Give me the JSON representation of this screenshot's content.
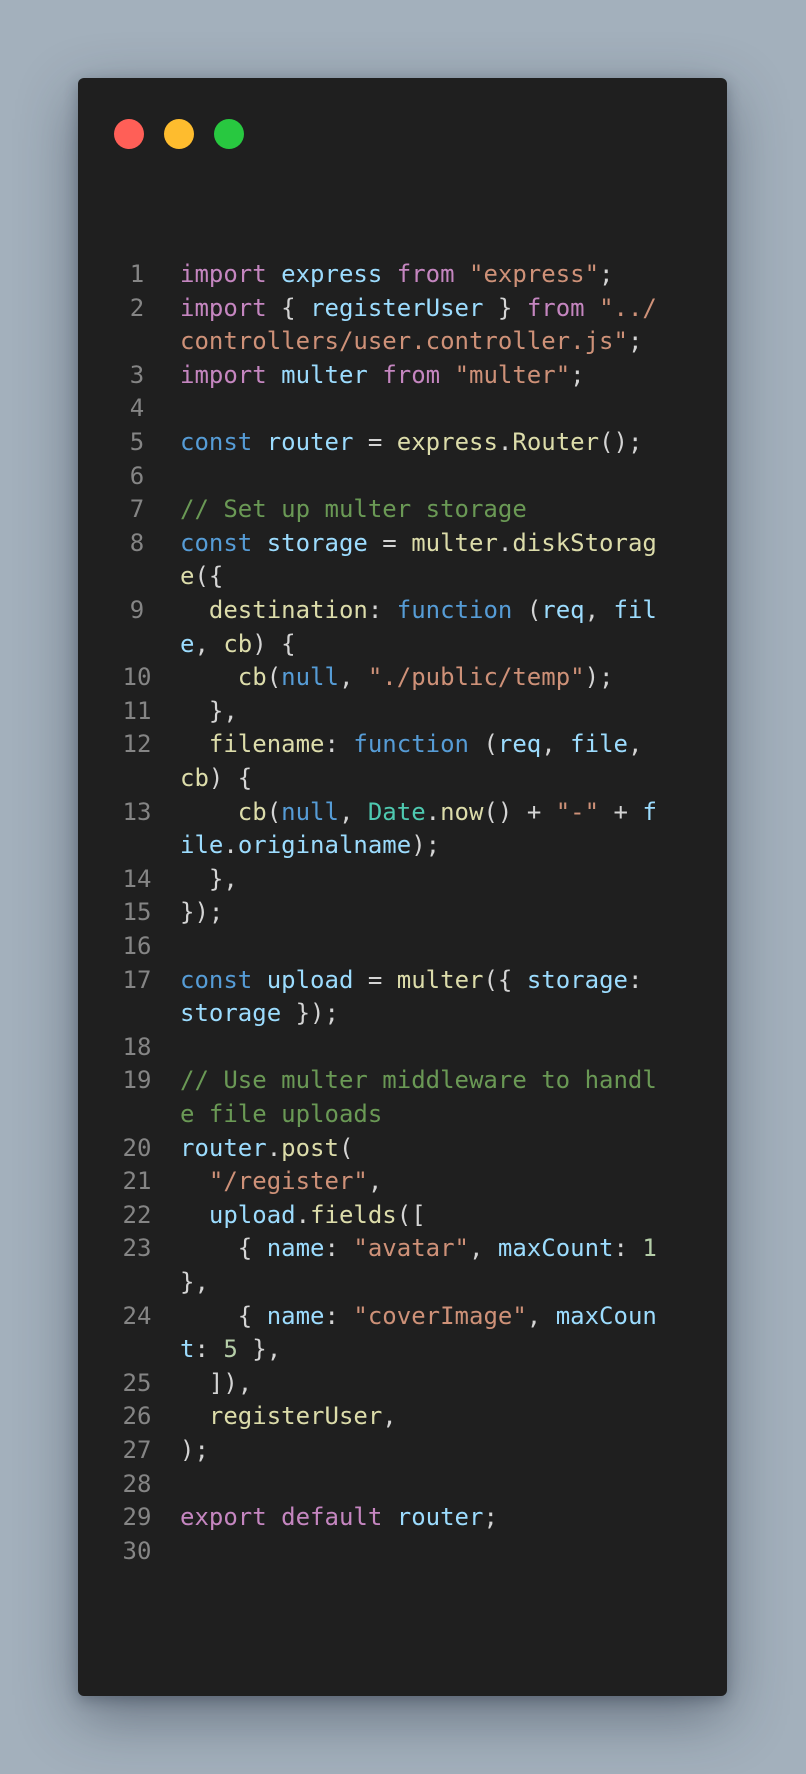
{
  "window": {
    "colors": {
      "background": "#1f1f1f",
      "red": "#ff5f57",
      "yellow": "#febc2e",
      "green": "#28c840"
    }
  },
  "syntax_colors": {
    "kw": "#c586c0",
    "var": "#9cdcfe",
    "str": "#ce9178",
    "plain": "#d4d4d4",
    "decl": "#569cd6",
    "fn": "#dcdcaa",
    "type": "#4ec9b0",
    "num": "#b5cea8",
    "cm": "#6a9955"
  },
  "code": {
    "lines": [
      {
        "n": "1",
        "rows": [
          [
            [
              "kw",
              "import "
            ],
            [
              "var",
              "express "
            ],
            [
              "kw",
              "from "
            ],
            [
              "str",
              "\"express\""
            ],
            [
              "plain",
              ";"
            ]
          ]
        ]
      },
      {
        "n": "2",
        "rows": [
          [
            [
              "kw",
              "import "
            ],
            [
              "plain",
              "{ "
            ],
            [
              "var",
              "registerUser "
            ],
            [
              "plain",
              "} "
            ],
            [
              "kw",
              "from "
            ],
            [
              "str",
              "\"../"
            ]
          ],
          [
            [
              "str",
              "controllers/user.controller.js\""
            ],
            [
              "plain",
              ";"
            ]
          ]
        ]
      },
      {
        "n": "3",
        "rows": [
          [
            [
              "kw",
              "import "
            ],
            [
              "var",
              "multer "
            ],
            [
              "kw",
              "from "
            ],
            [
              "str",
              "\"multer\""
            ],
            [
              "plain",
              ";"
            ]
          ]
        ]
      },
      {
        "n": "4",
        "rows": [
          []
        ]
      },
      {
        "n": "5",
        "rows": [
          [
            [
              "decl",
              "const "
            ],
            [
              "var",
              "router "
            ],
            [
              "plain",
              "= "
            ],
            [
              "fn",
              "express"
            ],
            [
              "plain",
              "."
            ],
            [
              "fn",
              "Router"
            ],
            [
              "plain",
              "();"
            ]
          ]
        ]
      },
      {
        "n": "6",
        "rows": [
          []
        ]
      },
      {
        "n": "7",
        "rows": [
          [
            [
              "cm",
              "// Set up multer storage"
            ]
          ]
        ]
      },
      {
        "n": "8",
        "rows": [
          [
            [
              "decl",
              "const "
            ],
            [
              "var",
              "storage "
            ],
            [
              "plain",
              "= "
            ],
            [
              "fn",
              "multer"
            ],
            [
              "plain",
              "."
            ],
            [
              "fn",
              "diskStorag"
            ]
          ],
          [
            [
              "fn",
              "e"
            ],
            [
              "plain",
              "({"
            ]
          ]
        ]
      },
      {
        "n": "9",
        "rows": [
          [
            [
              "plain",
              "  "
            ],
            [
              "fn",
              "destination"
            ],
            [
              "plain",
              ": "
            ],
            [
              "decl",
              "function "
            ],
            [
              "plain",
              "("
            ],
            [
              "var",
              "req"
            ],
            [
              "plain",
              ", "
            ],
            [
              "var",
              "fil"
            ]
          ],
          [
            [
              "var",
              "e"
            ],
            [
              "plain",
              ", "
            ],
            [
              "fn",
              "cb"
            ],
            [
              "plain",
              ") {"
            ]
          ]
        ]
      },
      {
        "n": "10",
        "rows": [
          [
            [
              "plain",
              "    "
            ],
            [
              "fn",
              "cb"
            ],
            [
              "plain",
              "("
            ],
            [
              "decl",
              "null"
            ],
            [
              "plain",
              ", "
            ],
            [
              "str",
              "\"./public/temp\""
            ],
            [
              "plain",
              ");"
            ]
          ]
        ]
      },
      {
        "n": "11",
        "rows": [
          [
            [
              "plain",
              "  },"
            ]
          ]
        ]
      },
      {
        "n": "12",
        "rows": [
          [
            [
              "plain",
              "  "
            ],
            [
              "fn",
              "filename"
            ],
            [
              "plain",
              ": "
            ],
            [
              "decl",
              "function "
            ],
            [
              "plain",
              "("
            ],
            [
              "var",
              "req"
            ],
            [
              "plain",
              ", "
            ],
            [
              "var",
              "file"
            ],
            [
              "plain",
              ","
            ]
          ],
          [
            [
              "fn",
              "cb"
            ],
            [
              "plain",
              ") {"
            ]
          ]
        ]
      },
      {
        "n": "13",
        "rows": [
          [
            [
              "plain",
              "    "
            ],
            [
              "fn",
              "cb"
            ],
            [
              "plain",
              "("
            ],
            [
              "decl",
              "null"
            ],
            [
              "plain",
              ", "
            ],
            [
              "type",
              "Date"
            ],
            [
              "plain",
              "."
            ],
            [
              "fn",
              "now"
            ],
            [
              "plain",
              "() + "
            ],
            [
              "str",
              "\"-\""
            ],
            [
              "plain",
              " + "
            ],
            [
              "var",
              "f"
            ]
          ],
          [
            [
              "var",
              "ile"
            ],
            [
              "plain",
              "."
            ],
            [
              "var",
              "originalname"
            ],
            [
              "plain",
              ");"
            ]
          ]
        ]
      },
      {
        "n": "14",
        "rows": [
          [
            [
              "plain",
              "  },"
            ]
          ]
        ]
      },
      {
        "n": "15",
        "rows": [
          [
            [
              "plain",
              "});"
            ]
          ]
        ]
      },
      {
        "n": "16",
        "rows": [
          []
        ]
      },
      {
        "n": "17",
        "rows": [
          [
            [
              "decl",
              "const "
            ],
            [
              "var",
              "upload "
            ],
            [
              "plain",
              "= "
            ],
            [
              "fn",
              "multer"
            ],
            [
              "plain",
              "({ "
            ],
            [
              "var",
              "storage"
            ],
            [
              "plain",
              ":"
            ]
          ],
          [
            [
              "var",
              "storage "
            ],
            [
              "plain",
              "});"
            ]
          ]
        ]
      },
      {
        "n": "18",
        "rows": [
          []
        ]
      },
      {
        "n": "19",
        "rows": [
          [
            [
              "cm",
              "// Use multer middleware to handl"
            ]
          ],
          [
            [
              "cm",
              "e file uploads"
            ]
          ]
        ]
      },
      {
        "n": "20",
        "rows": [
          [
            [
              "var",
              "router"
            ],
            [
              "plain",
              "."
            ],
            [
              "fn",
              "post"
            ],
            [
              "plain",
              "("
            ]
          ]
        ]
      },
      {
        "n": "21",
        "rows": [
          [
            [
              "plain",
              "  "
            ],
            [
              "str",
              "\"/register\""
            ],
            [
              "plain",
              ","
            ]
          ]
        ]
      },
      {
        "n": "22",
        "rows": [
          [
            [
              "plain",
              "  "
            ],
            [
              "var",
              "upload"
            ],
            [
              "plain",
              "."
            ],
            [
              "fn",
              "fields"
            ],
            [
              "plain",
              "(["
            ]
          ]
        ]
      },
      {
        "n": "23",
        "rows": [
          [
            [
              "plain",
              "    { "
            ],
            [
              "var",
              "name"
            ],
            [
              "plain",
              ": "
            ],
            [
              "str",
              "\"avatar\""
            ],
            [
              "plain",
              ", "
            ],
            [
              "var",
              "maxCount"
            ],
            [
              "plain",
              ": "
            ],
            [
              "num",
              "1"
            ]
          ],
          [
            [
              "plain",
              "},"
            ]
          ]
        ]
      },
      {
        "n": "24",
        "rows": [
          [
            [
              "plain",
              "    { "
            ],
            [
              "var",
              "name"
            ],
            [
              "plain",
              ": "
            ],
            [
              "str",
              "\"coverImage\""
            ],
            [
              "plain",
              ", "
            ],
            [
              "var",
              "maxCoun"
            ]
          ],
          [
            [
              "var",
              "t"
            ],
            [
              "plain",
              ": "
            ],
            [
              "num",
              "5"
            ],
            [
              "plain",
              " },"
            ]
          ]
        ]
      },
      {
        "n": "25",
        "rows": [
          [
            [
              "plain",
              "  ]),"
            ]
          ]
        ]
      },
      {
        "n": "26",
        "rows": [
          [
            [
              "plain",
              "  "
            ],
            [
              "fn",
              "registerUser"
            ],
            [
              "plain",
              ","
            ]
          ]
        ]
      },
      {
        "n": "27",
        "rows": [
          [
            [
              "plain",
              ");"
            ]
          ]
        ]
      },
      {
        "n": "28",
        "rows": [
          []
        ]
      },
      {
        "n": "29",
        "rows": [
          [
            [
              "kw",
              "export "
            ],
            [
              "kw",
              "default "
            ],
            [
              "var",
              "router"
            ],
            [
              "plain",
              ";"
            ]
          ]
        ]
      },
      {
        "n": "30",
        "rows": [
          []
        ]
      }
    ]
  }
}
